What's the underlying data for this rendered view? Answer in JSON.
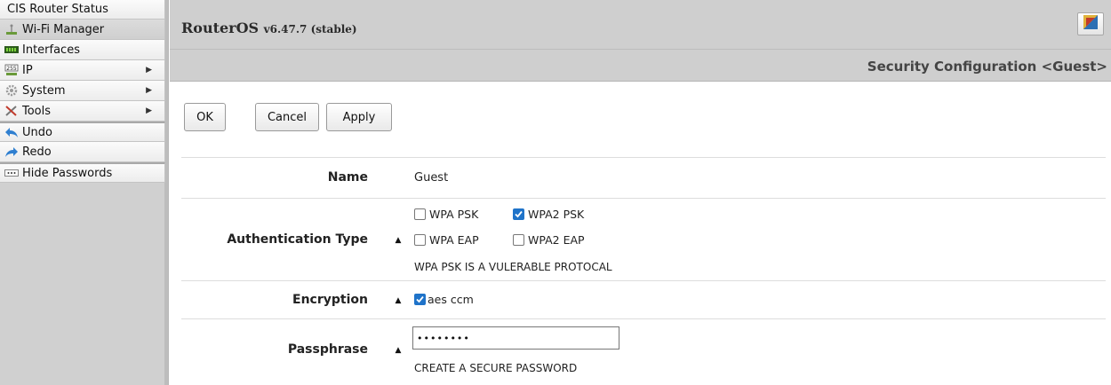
{
  "sidebar": {
    "items": [
      {
        "label": "CIS Router Status",
        "icon": "none"
      },
      {
        "label": "Wi-Fi Manager",
        "icon": "wifi-icon"
      },
      {
        "label": "Interfaces",
        "icon": "interfaces-icon"
      },
      {
        "label": "IP",
        "icon": "ip-icon"
      },
      {
        "label": "System",
        "icon": "gear-icon"
      },
      {
        "label": "Tools",
        "icon": "tools-icon"
      },
      {
        "label": "Undo",
        "icon": "undo-icon"
      },
      {
        "label": "Redo",
        "icon": "redo-icon"
      },
      {
        "label": "Hide Passwords",
        "icon": "password-dots-icon"
      }
    ],
    "submenu_arrow": "▶"
  },
  "header": {
    "brand": "RouterOS",
    "version": "v6.47.7 (stable)",
    "page_title": "Security Configuration <Guest>"
  },
  "toolbar": {
    "ok_label": "OK",
    "cancel_label": "Cancel",
    "apply_label": "Apply"
  },
  "form": {
    "name": {
      "label": "Name",
      "value": "Guest"
    },
    "auth": {
      "label": "Authentication Type",
      "options": [
        {
          "label": "WPA PSK",
          "checked": false
        },
        {
          "label": "WPA2 PSK",
          "checked": true
        },
        {
          "label": "WPA EAP",
          "checked": false
        },
        {
          "label": "WPA2 EAP",
          "checked": false
        }
      ],
      "hint": "WPA PSK IS A VULERABLE PROTOCAL"
    },
    "encryption": {
      "label": "Encryption",
      "options": [
        {
          "label": "aes ccm",
          "checked": true
        }
      ]
    },
    "passphrase": {
      "label": "Passphrase",
      "value": "••••••••",
      "hint": "CREATE A SECURE PASSWORD"
    },
    "toggle_glyph": "▲"
  },
  "colors": {
    "sidebar_bg": "#d0d0d0",
    "header_bg": "#cfcfcf",
    "checkbox_accent": "#1f73c9"
  }
}
